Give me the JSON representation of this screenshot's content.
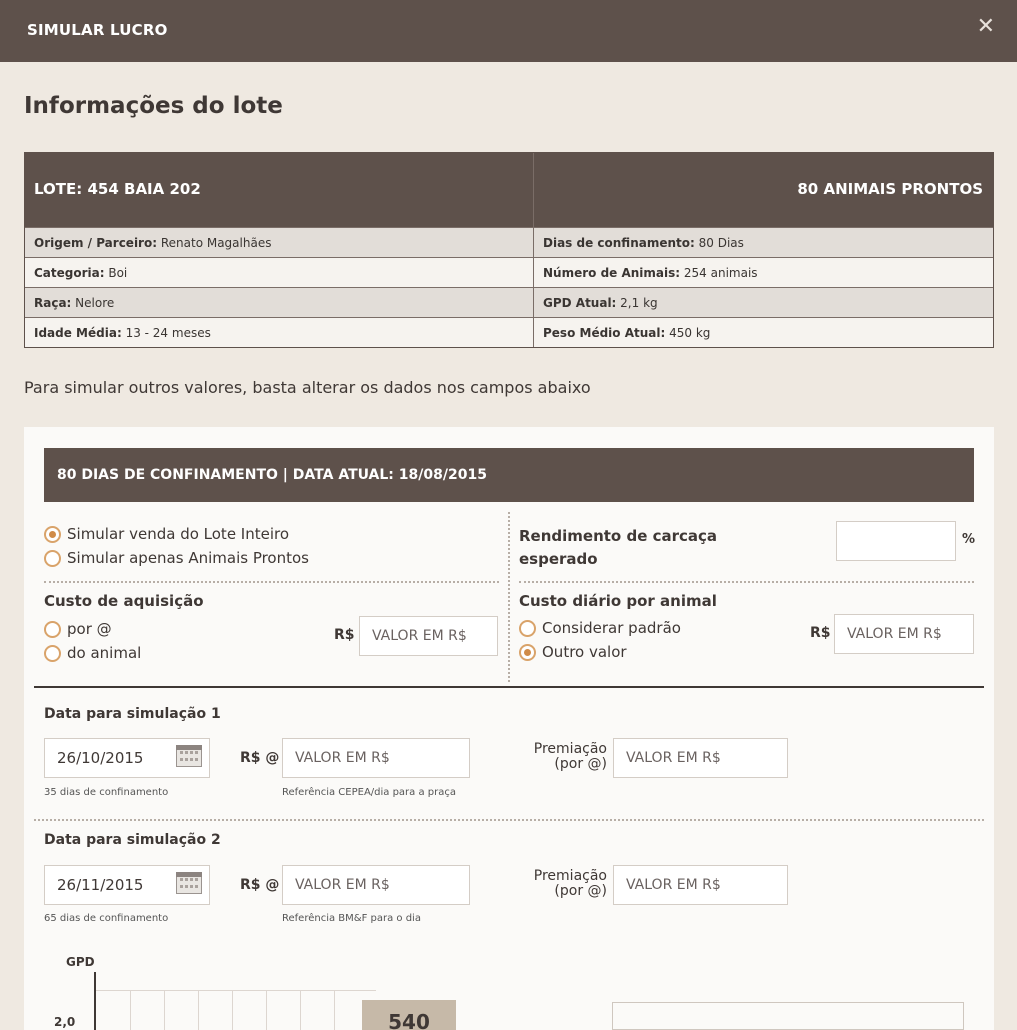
{
  "modal": {
    "title": "SIMULAR LUCRO",
    "close_icon": "close-icon"
  },
  "section_title": "Informações do lote",
  "lot": {
    "header_left": "LOTE: 454 BAIA 202",
    "header_right": "80 ANIMAIS PRONTOS",
    "rows": [
      {
        "l_label": "Origem / Parceiro:",
        "l_value": " Renato Magalhães",
        "r_label": "Dias de confinamento:",
        "r_value": " 80 Dias"
      },
      {
        "l_label": "Categoria:",
        "l_value": " Boi",
        "r_label": "Número de Animais:",
        "r_value": " 254 animais"
      },
      {
        "l_label": "Raça:",
        "l_value": " Nelore",
        "r_label": "GPD Atual:",
        "r_value": " 2,1 kg"
      },
      {
        "l_label": "Idade Média:",
        "l_value": " 13 - 24 meses",
        "r_label": "Peso Médio Atual:",
        "r_value": " 450 kg"
      }
    ]
  },
  "hint": "Para simular outros valores, basta alterar os dados nos campos abaixo",
  "sim": {
    "header": "80 DIAS DE CONFINAMENTO | DATA ATUAL: 18/08/2015",
    "scope_options": [
      "Simular venda do Lote Inteiro",
      "Simular apenas Animais Prontos"
    ],
    "yield_label_1": "Rendimento de carcaça",
    "yield_label_2": "esperado",
    "yield_unit": "%",
    "acq_label": "Custo de aquisição",
    "acq_options": [
      "por @",
      "do animal"
    ],
    "currency": "R$",
    "value_placeholder": "VALOR EM R$",
    "daily_label": "Custo diário por animal",
    "daily_options": [
      "Considerar padrão",
      "Outro valor"
    ],
    "date1": {
      "label": "Data para simulação 1",
      "date": "26/10/2015",
      "days": "35 dias de confinamento",
      "price_label": "R$ @",
      "price_placeholder": "VALOR EM R$",
      "ref": "Referência CEPEA/dia para a praça",
      "premium_1": "Premiação",
      "premium_2": "(por @)",
      "premium_placeholder": "VALOR EM R$"
    },
    "date2": {
      "label": "Data para simulação 2",
      "date": "26/11/2015",
      "days": "65 dias de confinamento",
      "price_label": "R$ @",
      "price_placeholder": "VALOR EM R$",
      "ref": "Referência BM&F para o dia",
      "premium_1": "Premiação",
      "premium_2": "(por @)",
      "premium_placeholder": "VALOR EM R$"
    }
  },
  "chart": {
    "y_label": "GPD",
    "y_tick": "2,0",
    "badge": "540"
  }
}
